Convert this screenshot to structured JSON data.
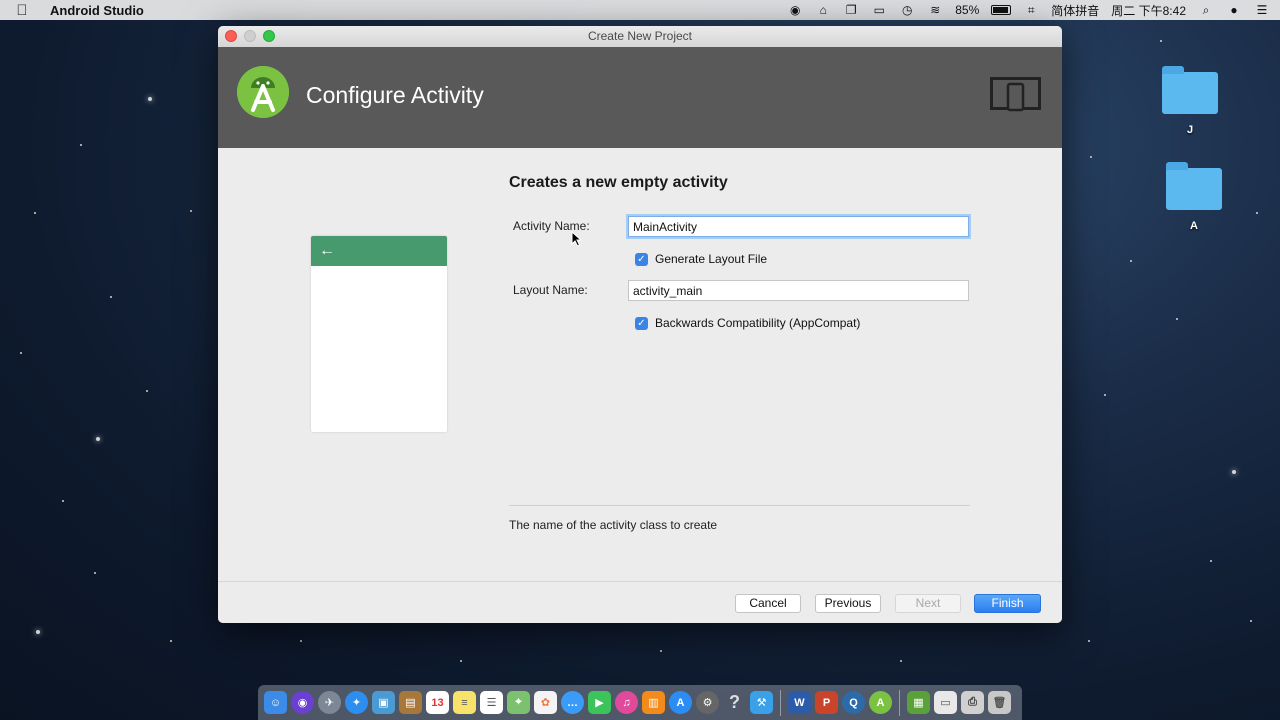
{
  "menubar": {
    "app_name": "Android Studio",
    "battery_percent": "85%",
    "input_method": "简体拼音",
    "datetime": "周二 下午8:42"
  },
  "desktop": {
    "folders": [
      {
        "label": "J"
      },
      {
        "label": "A"
      }
    ]
  },
  "window": {
    "title": "Create New Project",
    "header_title": "Configure Activity",
    "form": {
      "title": "Creates a new empty activity",
      "activity_name_label": "Activity Name:",
      "activity_name_value": "MainActivity",
      "generate_layout_label": "Generate Layout File",
      "generate_layout_checked": true,
      "layout_name_label": "Layout Name:",
      "layout_name_value": "activity_main",
      "backwards_compat_label": "Backwards Compatibility (AppCompat)",
      "backwards_compat_checked": true,
      "description": "The name of the activity class to create"
    },
    "preview": {
      "back_arrow": "←",
      "toolbar_color": "#479a6d"
    },
    "buttons": {
      "cancel": "Cancel",
      "previous": "Previous",
      "next": "Next",
      "finish": "Finish"
    }
  },
  "dock": {
    "icons": [
      "finder-icon",
      "siri-icon",
      "launchpad-icon",
      "safari-icon",
      "preview-icon",
      "notes-icon",
      "calendar-icon",
      "stickies-icon",
      "reminders-icon",
      "maps-icon",
      "photos-icon",
      "messages-icon",
      "facetime-icon",
      "itunes-icon",
      "ibooks-icon",
      "appstore-icon",
      "system-preferences-icon",
      "help-icon",
      "xcode-icon",
      "word-icon",
      "powerpoint-icon",
      "quicktime-icon",
      "android-studio-icon",
      "clipboard-icon",
      "screenshot-icon",
      "printer-icon",
      "trash-icon"
    ]
  }
}
